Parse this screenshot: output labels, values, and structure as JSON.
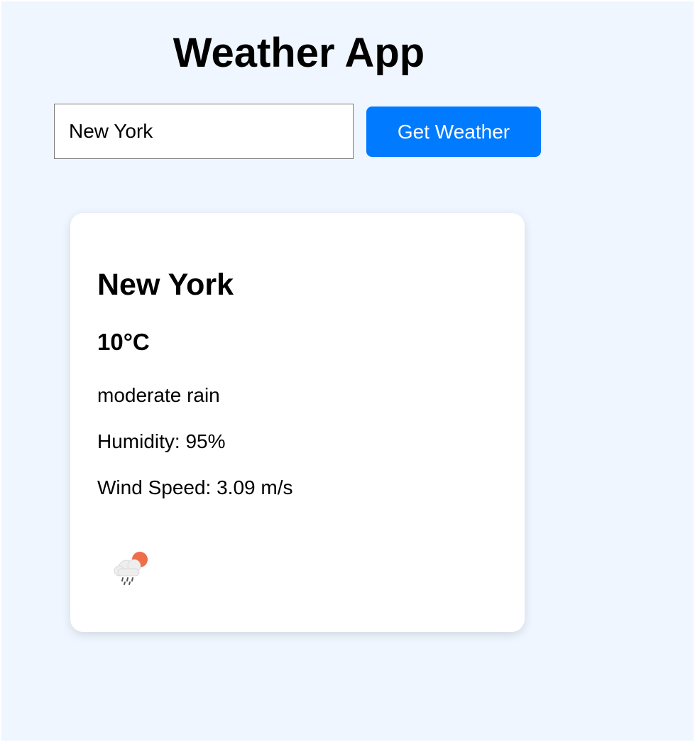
{
  "header": {
    "title": "Weather App"
  },
  "search": {
    "value": "New York",
    "button_label": "Get Weather"
  },
  "weather": {
    "city": "New York",
    "temperature": "10°C",
    "description": "moderate rain",
    "humidity_text": "Humidity: 95%",
    "wind_text": "Wind Speed: 3.09 m/s",
    "icon": "rain-cloud-sun-icon"
  },
  "colors": {
    "page_background": "#eff6ff",
    "button": "#007bff",
    "sun": "#ee6e4a",
    "cloud": "#eeeeee",
    "rain": "#555555"
  }
}
